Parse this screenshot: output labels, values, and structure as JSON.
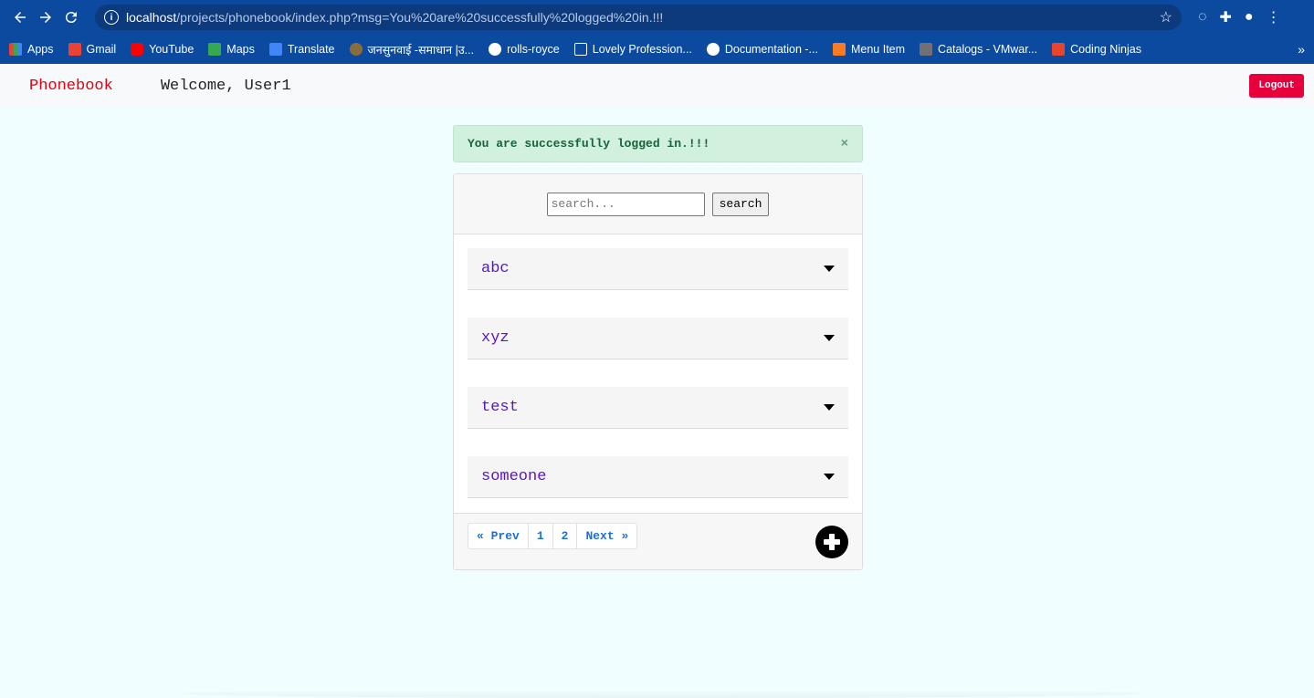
{
  "browser": {
    "url_host": "localhost",
    "url_path": "/projects/phonebook/index.php?msg=You%20are%20successfully%20logged%20in.!!!",
    "bookmarks": [
      {
        "label": "Apps",
        "icon": "apps-grid-icon",
        "color": "#e94235"
      },
      {
        "label": "Gmail",
        "icon": "gmail-icon",
        "color": "#ea4335"
      },
      {
        "label": "YouTube",
        "icon": "youtube-icon",
        "color": "#ff0000"
      },
      {
        "label": "Maps",
        "icon": "maps-icon",
        "color": "#34a853"
      },
      {
        "label": "Translate",
        "icon": "translate-icon",
        "color": "#4285f4"
      },
      {
        "label": "जनसुनवाई -समाधान |उ...",
        "icon": "emblem-icon",
        "color": "#8a6d3b"
      },
      {
        "label": "rolls-royce",
        "icon": "globe-icon",
        "color": "#ffffff"
      },
      {
        "label": "Lovely Profession...",
        "icon": "external-link-icon",
        "color": "#ffffff"
      },
      {
        "label": "Documentation -...",
        "icon": "globe-icon",
        "color": "#ffffff"
      },
      {
        "label": "Menu Item",
        "icon": "xampp-icon",
        "color": "#fb7a24"
      },
      {
        "label": "Catalogs - VMwar...",
        "icon": "vmware-icon",
        "color": "#717074"
      },
      {
        "label": "Coding Ninjas",
        "icon": "coding-ninjas-icon",
        "color": "#e8442e"
      }
    ]
  },
  "nav": {
    "brand": "Phonebook",
    "welcome": "Welcome, User1",
    "logout_label": "Logout"
  },
  "alert": {
    "message": "You are successfully logged in.!!!",
    "close_symbol": "×"
  },
  "search": {
    "placeholder": "search...",
    "button_label": "search"
  },
  "contacts": [
    {
      "name": "abc"
    },
    {
      "name": "xyz"
    },
    {
      "name": "test"
    },
    {
      "name": "someone"
    }
  ],
  "pagination": {
    "prev": "« Prev",
    "pages": [
      "1",
      "2"
    ],
    "next": "Next »"
  },
  "colors": {
    "accent_red": "#e3000f",
    "logout_bg": "#e8003d",
    "contact_name": "#5b13c9",
    "link_blue": "#1a6fd8",
    "page_bg": "#f0feff"
  }
}
